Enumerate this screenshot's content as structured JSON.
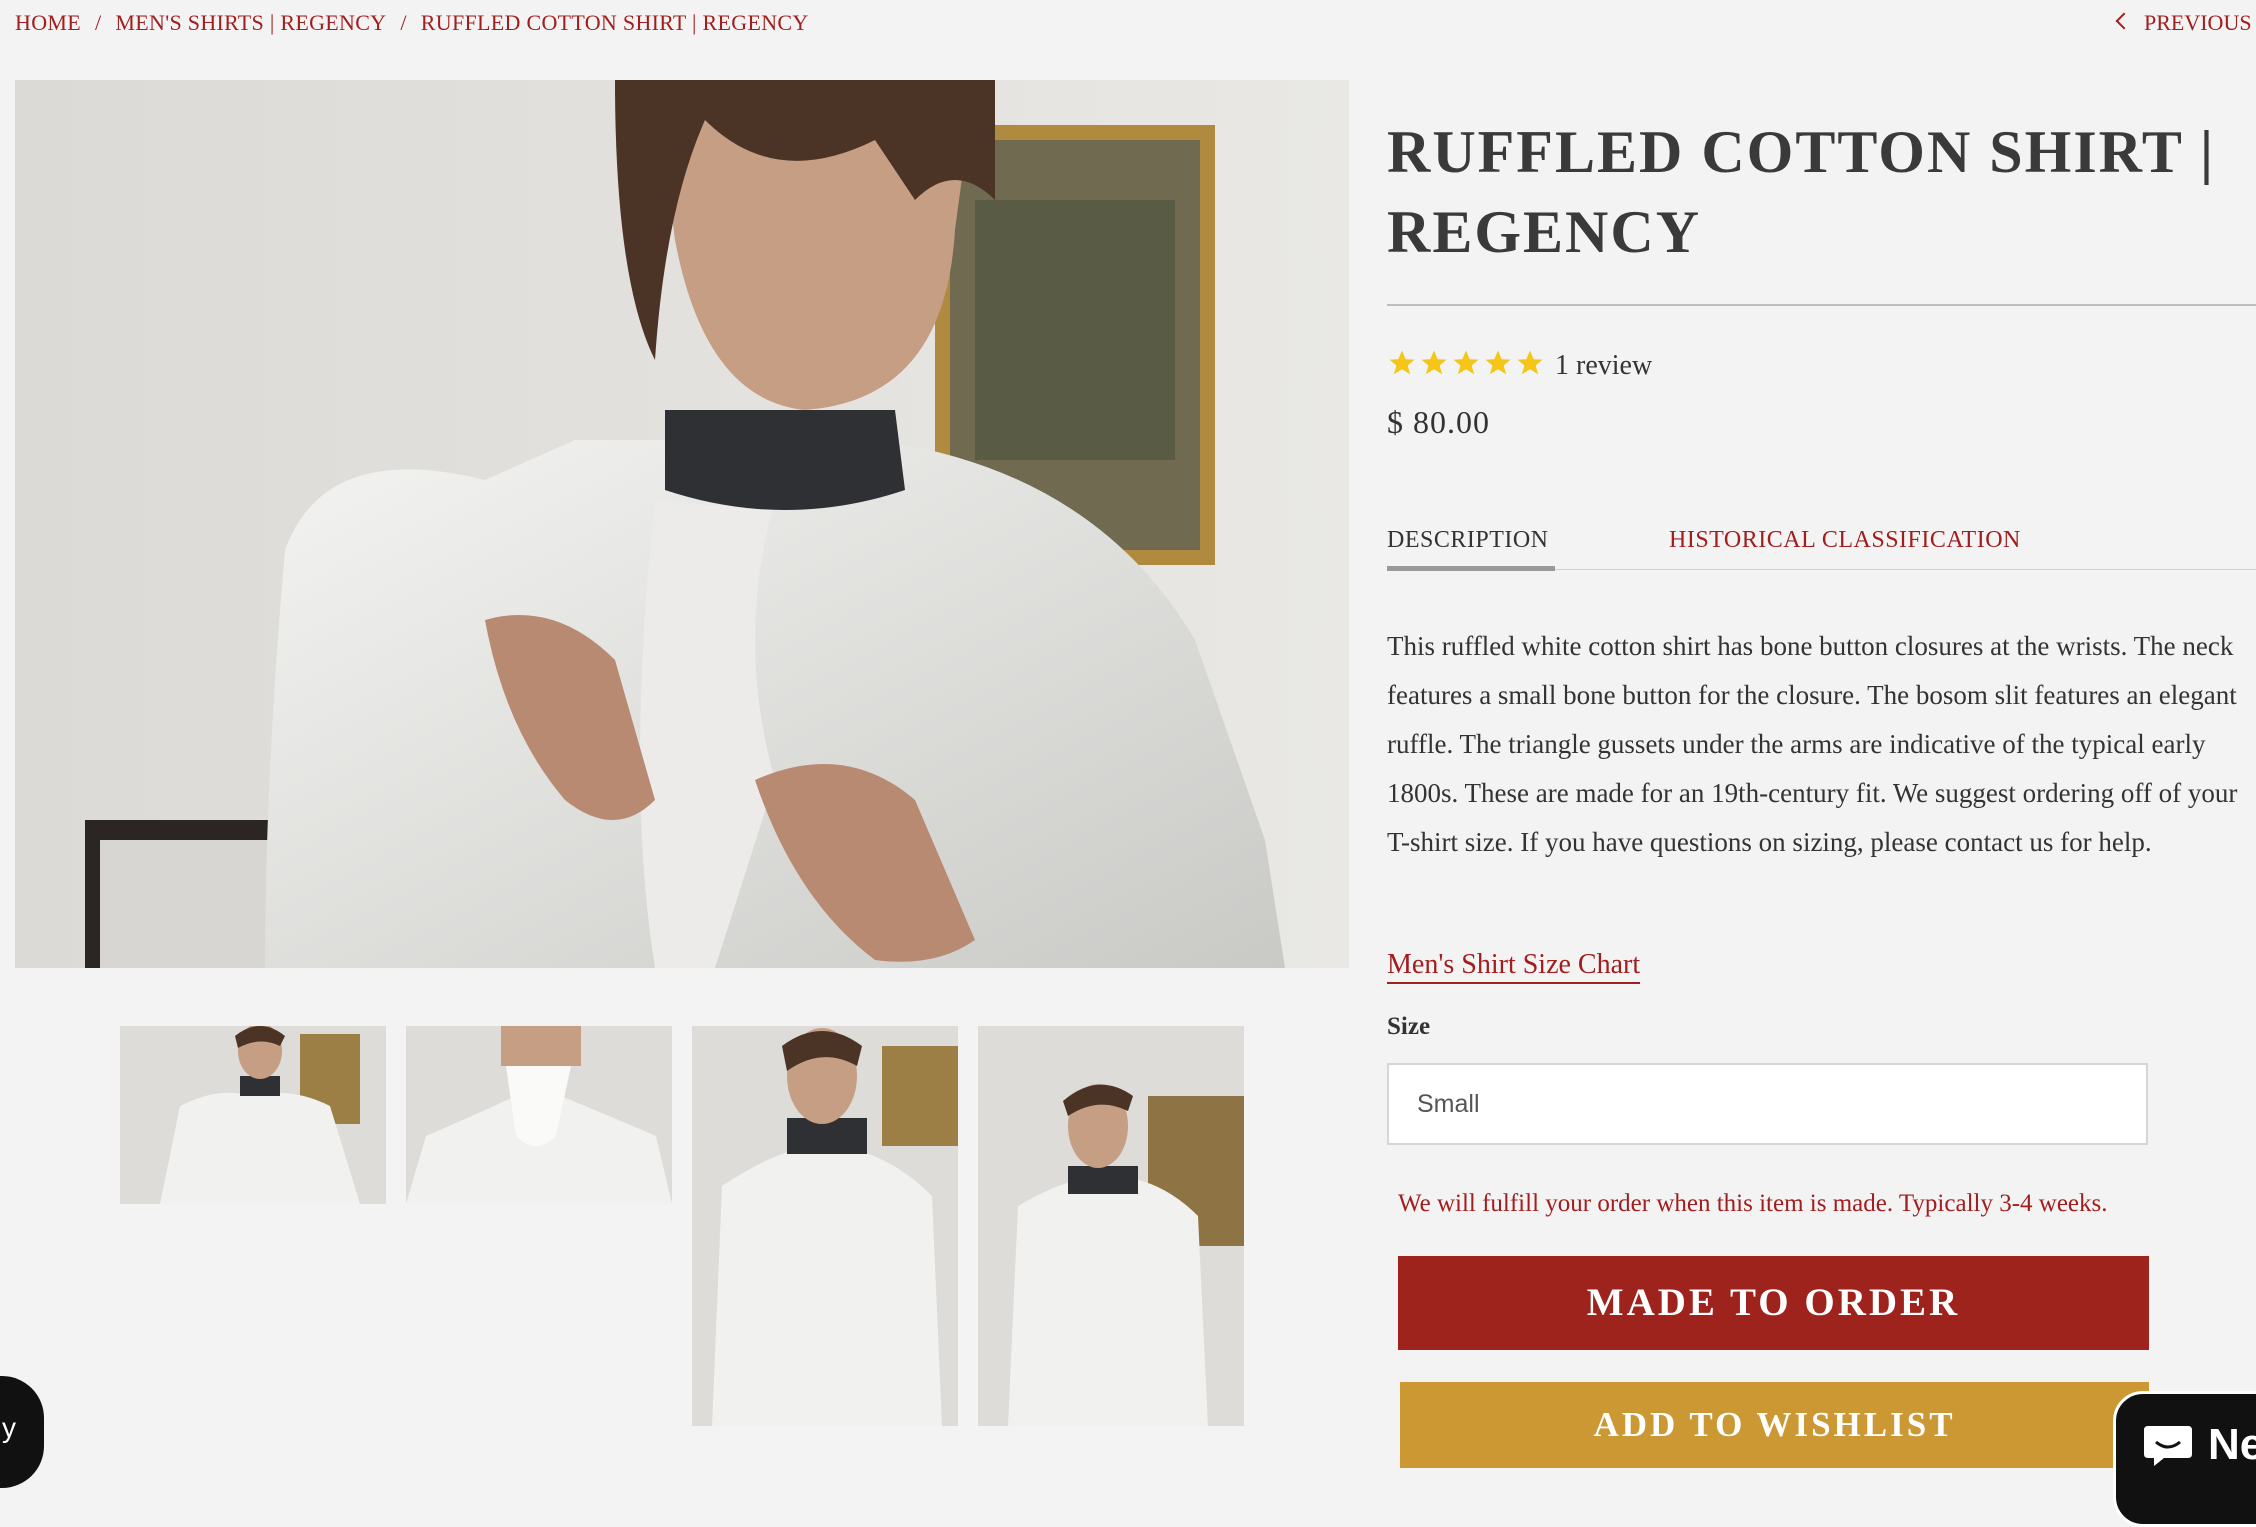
{
  "breadcrumb": {
    "home": "HOME",
    "category": "MEN'S SHIRTS | REGENCY",
    "current": "RUFFLED COTTON SHIRT | REGENCY",
    "separator": "/"
  },
  "nav": {
    "previous": "PREVIOUS"
  },
  "product": {
    "title_line1": "RUFFLED COTTON SHIRT |",
    "title_line2": "REGENCY",
    "rating": 5,
    "rating_max": 5,
    "review_count": "1 review",
    "price": "$ 80.00",
    "tabs": [
      {
        "label": "DESCRIPTION",
        "active": true
      },
      {
        "label": "HISTORICAL CLASSIFICATION",
        "active": false
      }
    ],
    "description": "This  ruffled  white cotton shirt has bone button closures at the wrists. The neck features a small bone button for the closure. The bosom slit features an elegant ruffle.  The triangle gussets under the arms are indicative of the typical early 1800s. These are made for an 19th-century fit. We suggest ordering off of your T-shirt size. If you have questions on sizing, please contact us for help.",
    "size_chart_link": "Men's Shirt Size Chart",
    "size_label": "Size",
    "size_selected": "Small",
    "fulfill_note": "We will fulfill your order when this item is made. Typically 3-4 weeks.",
    "order_button": "MADE TO ORDER",
    "wishlist_button": "ADD TO WISHLIST"
  },
  "chat": {
    "label": "Ne"
  },
  "left_widget": {
    "label": "y"
  },
  "colors": {
    "accent_red": "#9e231c",
    "link_red": "#a21e1e",
    "wishlist_gold": "#cb9834",
    "star_yellow": "#f5c518",
    "background": "#f3f3f3"
  },
  "icons": [
    "chevron-left-icon",
    "star-icon",
    "chat-bubble-icon"
  ]
}
